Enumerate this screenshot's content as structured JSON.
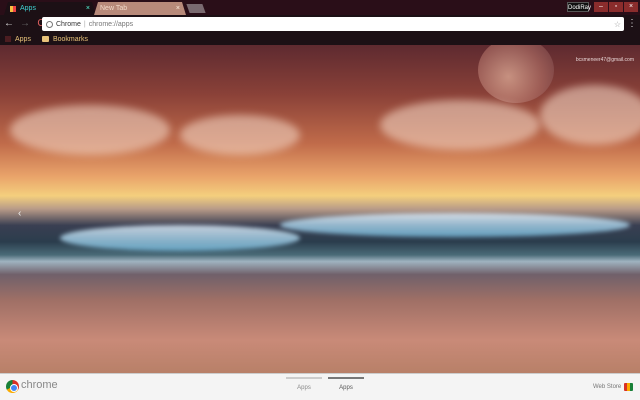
{
  "tabs": [
    {
      "label": "Apps",
      "close": "×"
    },
    {
      "label": "New Tab",
      "close": "×"
    }
  ],
  "profile": {
    "label": "DodiRay"
  },
  "window_controls": {
    "minimize": "–",
    "maximize": "▫",
    "close": "×"
  },
  "nav": {
    "back": "←",
    "forward": "→",
    "reload": "C"
  },
  "omnibox": {
    "site_label": "Chrome",
    "separator": "|",
    "url": "chrome://apps",
    "star": "☆"
  },
  "menu": {
    "icon": "⋮"
  },
  "bookmarks": [
    {
      "label": "Apps"
    },
    {
      "label": "Bookmarks"
    }
  ],
  "content": {
    "user_email": "bcsmeneer47@gmail.com",
    "prev_arrow": "‹"
  },
  "bottombar": {
    "brand": "chrome",
    "pages": [
      {
        "label": "Apps",
        "active": false
      },
      {
        "label": "Apps",
        "active": true
      }
    ],
    "webstore": "Web Store"
  }
}
